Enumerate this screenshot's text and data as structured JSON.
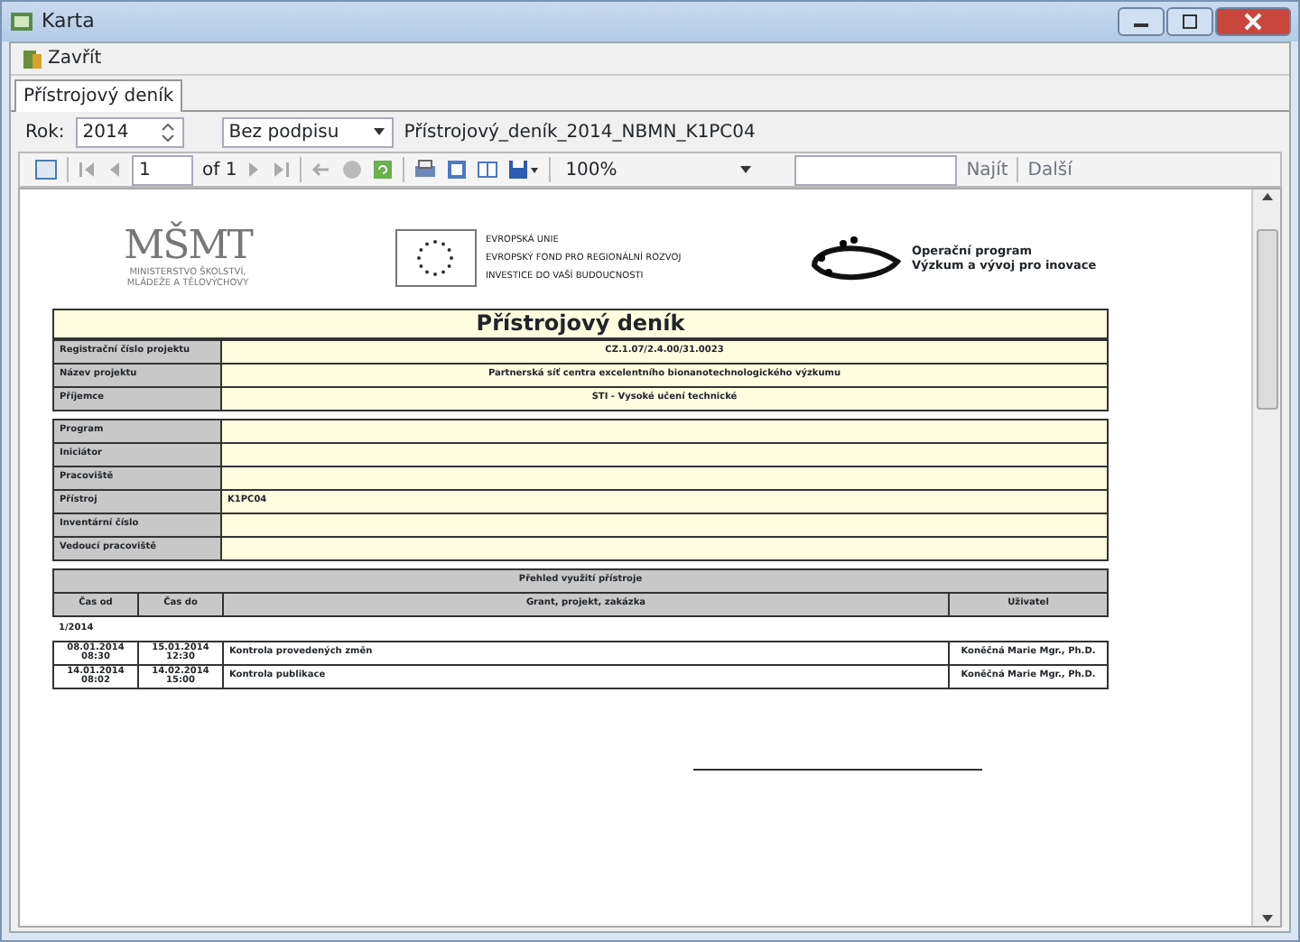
{
  "window": {
    "title": "Karta"
  },
  "toolbar": {
    "close_label": "Zavřít"
  },
  "tabs": [
    {
      "label": "Přístrojový deník",
      "selected": true
    }
  ],
  "params": {
    "year_label": "Rok:",
    "year": "2014",
    "signature": "Bez podpisu",
    "report_name": "Přístrojový_deník_2014_NBMN_K1PC04"
  },
  "report_toolbar": {
    "page": "1",
    "page_of": "of 1",
    "zoom": "100%",
    "find": "Najít",
    "next": "Další"
  },
  "report": {
    "msmt": {
      "logo": "MŠMT",
      "line1": "MINISTERSTVO ŠKOLSTVÍ,",
      "line2": "MLÁDEŽE A TĚLOVÝCHOVY"
    },
    "eu": [
      "EVROPSKÁ UNIE",
      "EVROPSKÝ FOND PRO REGIONÁLNÍ ROZVOJ",
      "INVESTICE DO VAŠÍ BUDOUCNOSTI"
    ],
    "op": [
      "Operační program",
      "Výzkum a vývoj pro inovace"
    ],
    "title": "Přístrojový deník",
    "project_fields": [
      {
        "label": "Registrační číslo projektu",
        "value": "CZ.1.07/2.4.00/31.0023"
      },
      {
        "label": "Název projektu",
        "value": "Partnerská síť centra excelentního bionanotechnologického výzkumu"
      },
      {
        "label": "Příjemce",
        "value": "STI - Vysoké učení technické"
      }
    ],
    "device_fields": [
      {
        "label": "Program"
      },
      {
        "label": "Iniciátor"
      },
      {
        "label": "Pracoviště"
      },
      {
        "label": "Přístroj",
        "value": "K1PC04"
      },
      {
        "label": "Inventární číslo"
      },
      {
        "label": "Vedoucí pracoviště"
      }
    ],
    "usage_title": "Přehled využití přístroje",
    "columns": [
      "Čas od",
      "Čas do",
      "Grant, projekt, zakázka",
      "Uživatel"
    ],
    "group": "1/2014",
    "rows": [
      {
        "from": [
          "08.01.2014",
          "08:30"
        ],
        "to": [
          "15.01.2014",
          "12:30"
        ],
        "grant": "Kontrola provedených změn",
        "user": "Koněčná Marie Mgr., Ph.D."
      },
      {
        "from": [
          "14.01.2014",
          "08:02"
        ],
        "to": [
          "14.02.2014",
          "15:00"
        ],
        "grant": "Kontrola publikace",
        "user": "Koněčná Marie Mgr., Ph.D."
      }
    ]
  }
}
